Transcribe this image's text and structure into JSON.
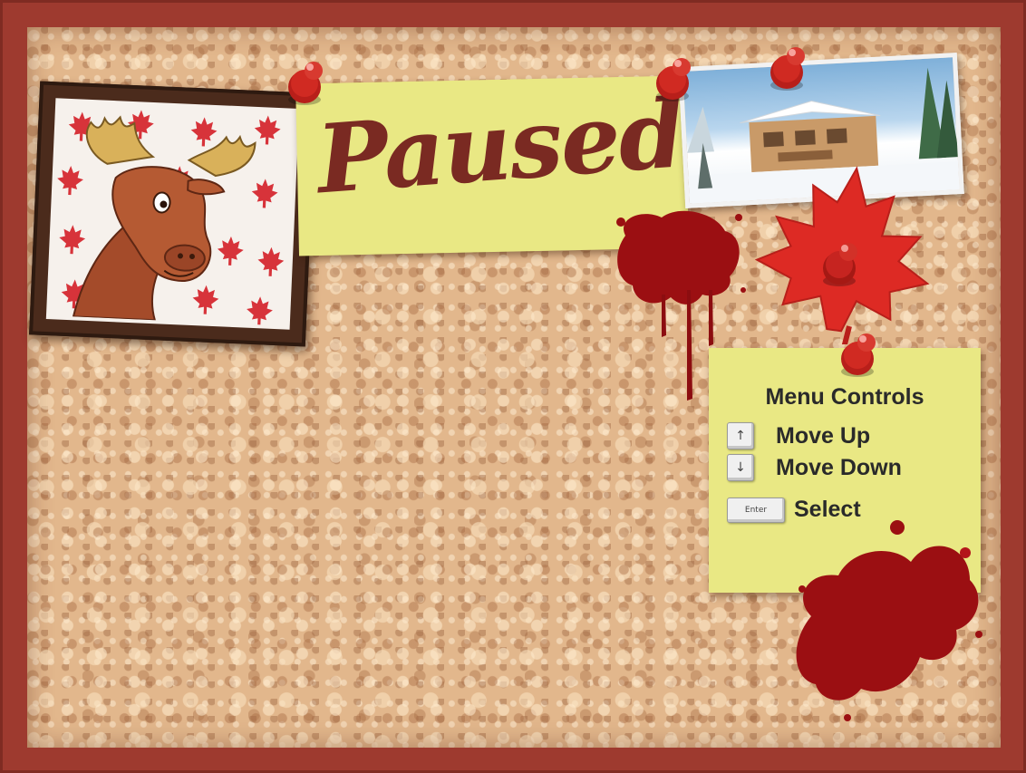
{
  "pause_screen": {
    "title": "Paused"
  },
  "menu_controls": {
    "title": "Menu Controls",
    "controls": [
      {
        "key": "↑",
        "label": "Move Up"
      },
      {
        "key": "↓",
        "label": "Move Down"
      },
      {
        "key": "Enter",
        "label": "Select"
      }
    ]
  },
  "colors": {
    "frame": "#9e3a2f",
    "cork": "#e2b78c",
    "sticky_note": "#e9e884",
    "pin_red": "#d02a22",
    "blood": "#9b0f12",
    "maple_leaf": "#dd2a24",
    "paused_text": "#7a2a22"
  },
  "icons": [
    "push-pin-icon",
    "maple-leaf-icon",
    "moose-icon",
    "blood-splat-icon",
    "up-arrow-key-icon",
    "down-arrow-key-icon",
    "enter-key-icon"
  ]
}
